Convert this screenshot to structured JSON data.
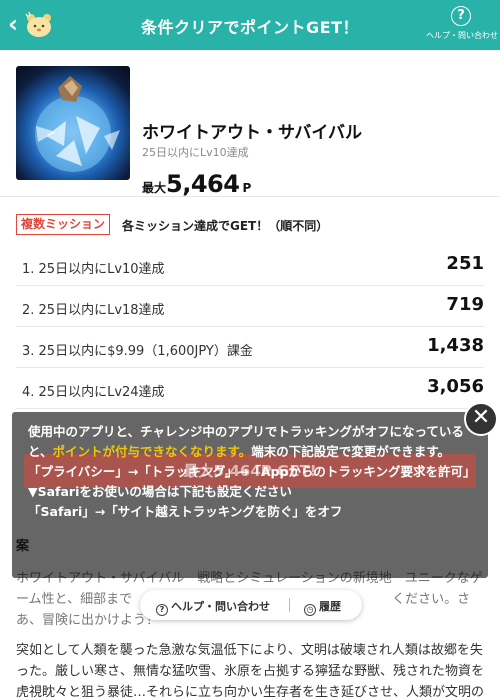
{
  "header": {
    "title": "条件クリアでポイントGET！",
    "help_label": "ヘルプ・問い合わせ",
    "help_icon": "question-circle-icon",
    "back_icon": "chevron-left-icon",
    "mascot_icon": "bear-mascot-icon",
    "bg_color": "#29b3a8"
  },
  "app": {
    "name": "ホワイトアウト・サバイバル",
    "subtitle": "25日以内にLv10達成",
    "points_prefix": "最大",
    "points_value": "5,464",
    "points_unit": "P"
  },
  "missions": {
    "badge": "複数ミッション",
    "description": "各ミッション達成でGET！（順不同）",
    "items": [
      {
        "label": "1. 25日以内にLv10達成",
        "value": "251"
      },
      {
        "label": "2. 25日以内にLv18達成",
        "value": "719"
      },
      {
        "label": "3. 25日以内に$9.99（1,600JPY）課金",
        "value": "1,438"
      },
      {
        "label": "4. 25日以内にLv24達成",
        "value": "3,056"
      }
    ]
  },
  "background_text": {
    "section_head": "案",
    "para1": "ホワイトアウト・サバイバル　戦略とシミュレーションの新境地　ユニークなゲーム性と、細部まで　　　　　　　　　　　　　　　　　　　　ください。さあ、冒険に出かけよう！",
    "para2": "突如として人類を襲った急激な気温低下により、文明は破壊され人類は故郷を失った。厳しい寒さ、無情な猛吹雪、氷原を占拠する獰猛な野獣、残された物資を虎視眈々と狙う暴徒…それらに立ち向かい生存者を生き延びさせ、人類が文明の"
  },
  "bottom_bar": {
    "help_label": "ヘルプ・問い合わせ",
    "history_label": "履歴",
    "help_icon": "question-circle-icon",
    "history_icon": "clock-history-icon"
  },
  "overlay": {
    "line1": "使用中のアプリと、チャレンジ中のアプリでトラッキングがオフになっていると、",
    "highlight": "ポイントが付与できなくなります。",
    "line1_end": "端末の下記設定で変更ができます。",
    "line2": "「プライバシー」→「トラッキング」→「Appからのトラッキング要求を許可」",
    "line3": "▼Safariをお使いの場合は下記も設定ください",
    "line4": "「Safari」→「サイト越えトラッキングを防ぐ」をオフ",
    "faded_button": "最大5,464P GET!",
    "close_icon": "close-x-icon",
    "highlight_color": "#f5c400"
  }
}
